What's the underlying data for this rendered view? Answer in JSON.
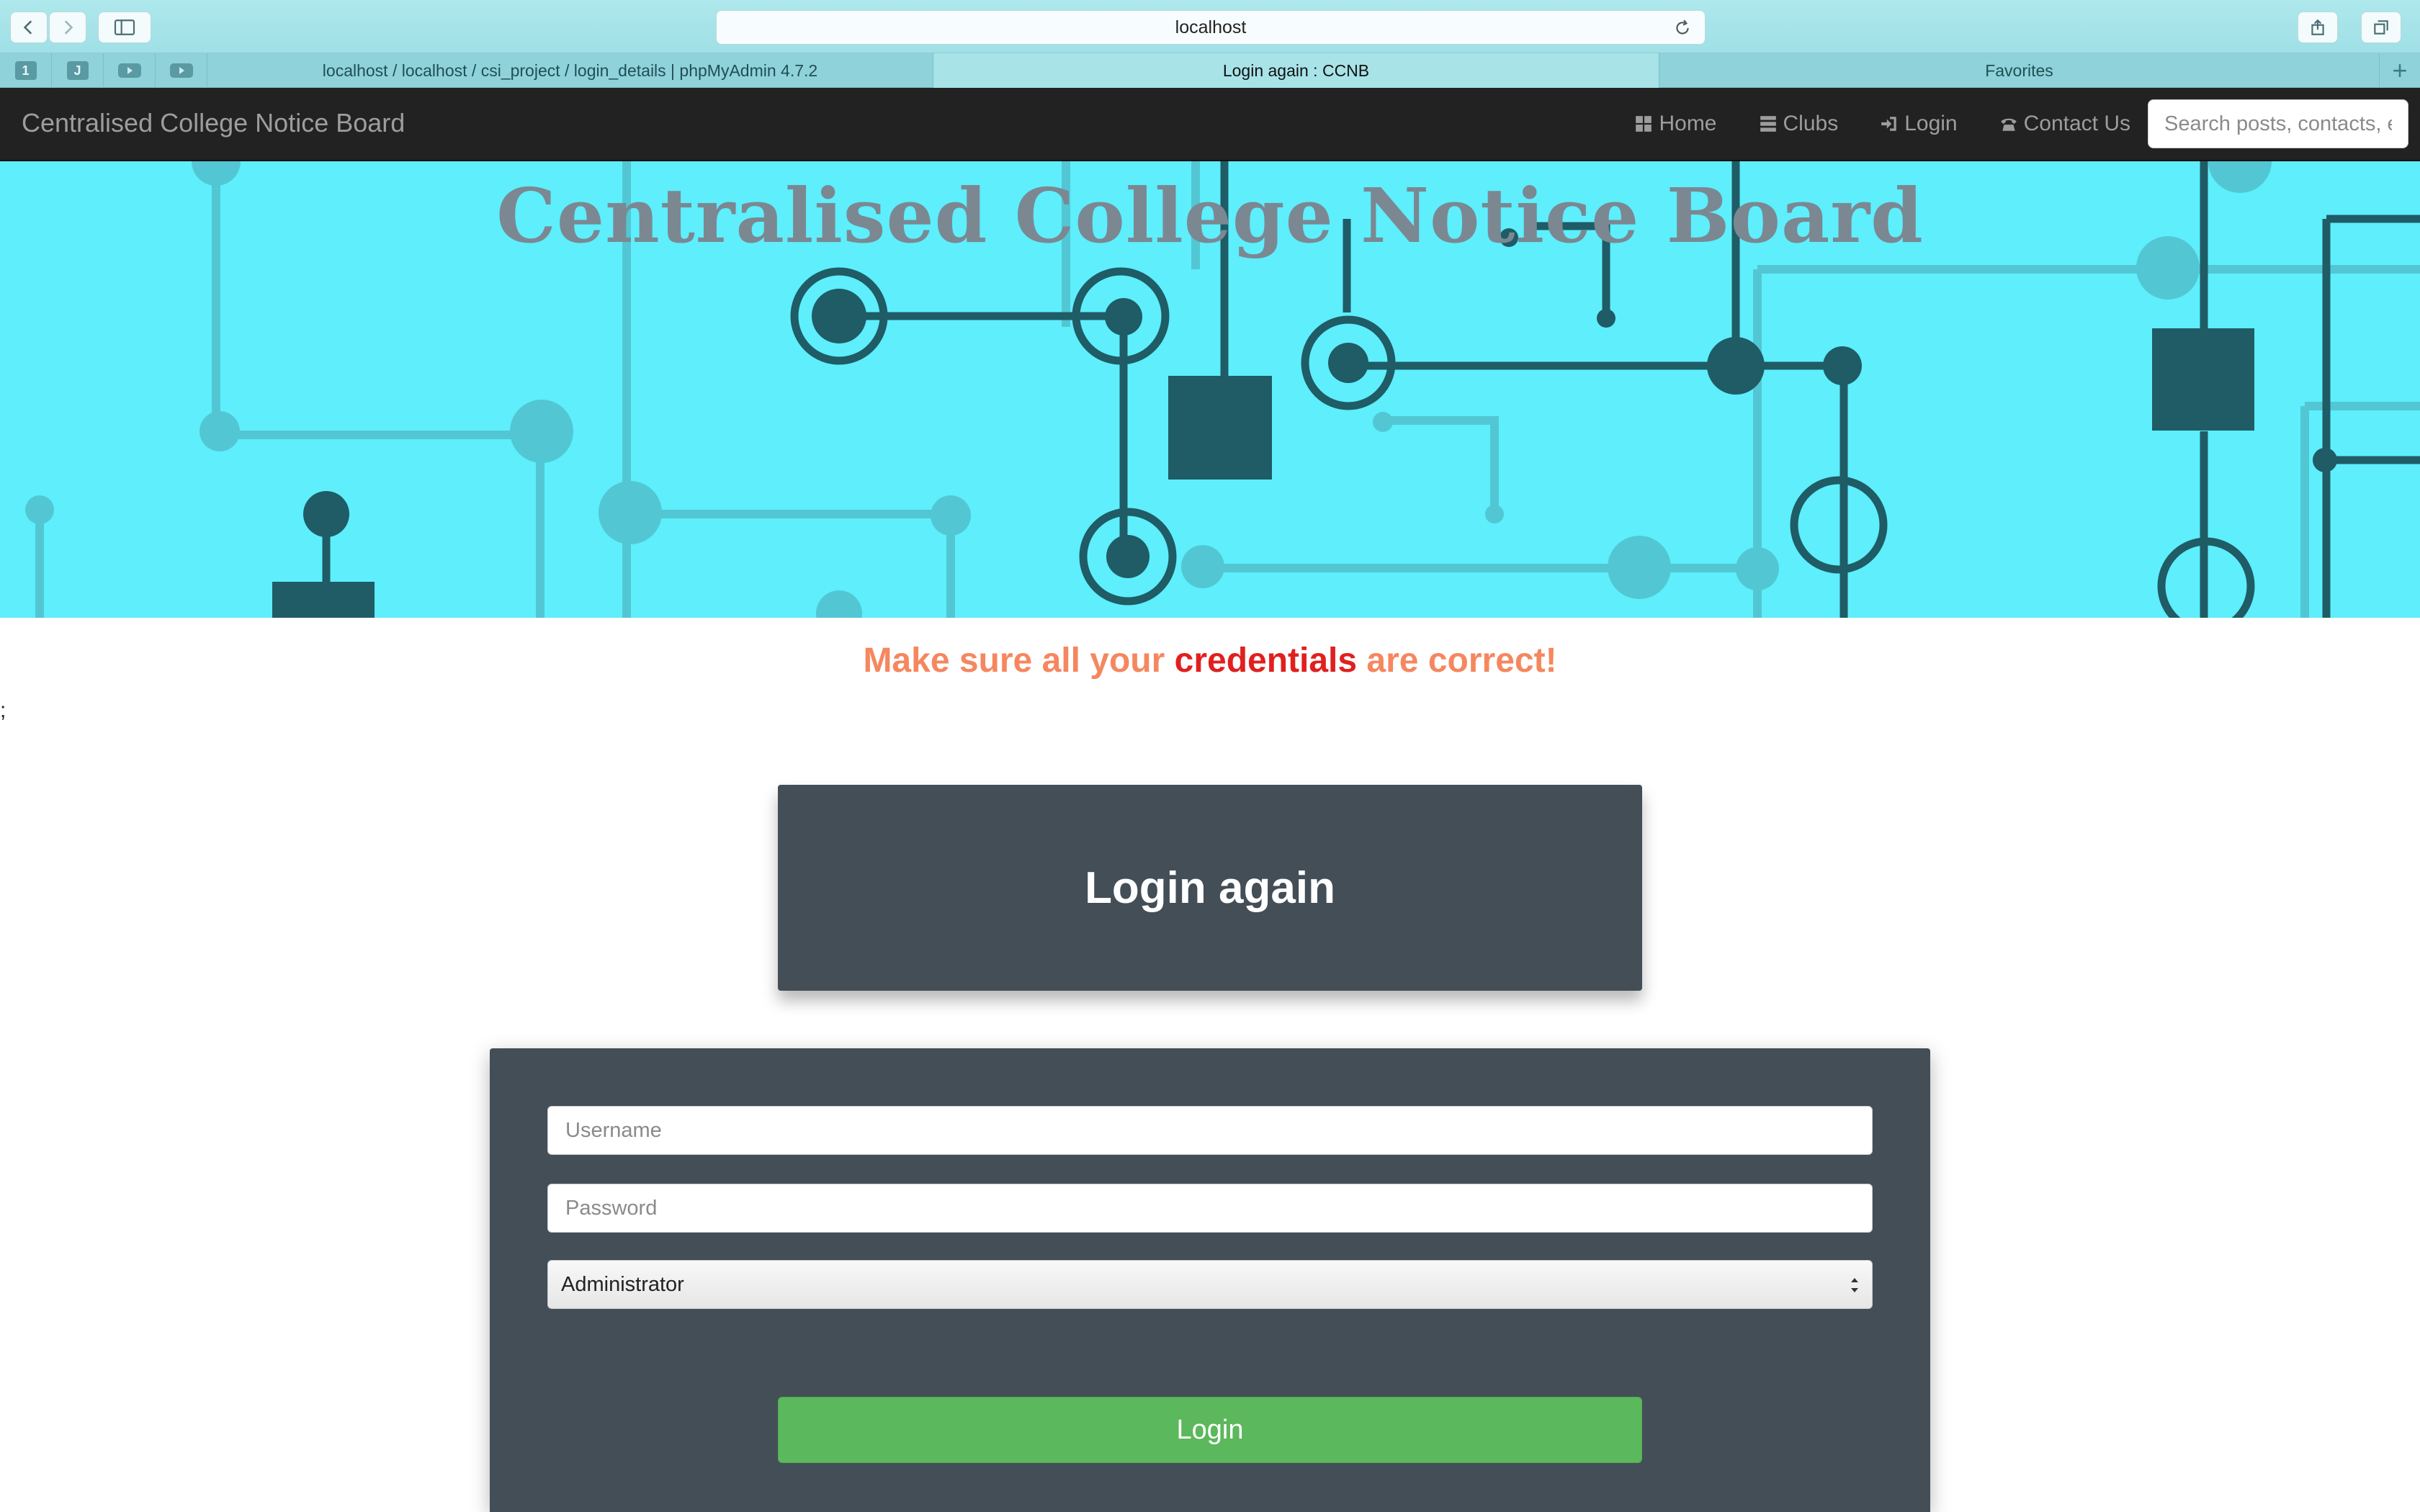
{
  "browser": {
    "url": "localhost",
    "tabs": [
      {
        "label": "localhost / localhost / csi_project / login_details | phpMyAdmin 4.7.2",
        "active": false
      },
      {
        "label": "Login again : CCNB",
        "active": true
      },
      {
        "label": "Favorites",
        "active": false
      }
    ],
    "pinned": [
      "1",
      "J"
    ]
  },
  "navbar": {
    "brand": "Centralised College Notice Board",
    "links": [
      {
        "label": "Home",
        "icon": "grid-icon"
      },
      {
        "label": "Clubs",
        "icon": "list-icon"
      },
      {
        "label": "Login",
        "icon": "sign-in-icon"
      },
      {
        "label": "Contact Us",
        "icon": "phone-icon"
      }
    ],
    "search_placeholder": "Search posts, contacts, etc"
  },
  "banner": {
    "title": "Centralised College Notice Board",
    "background": "#5eeefc",
    "circuit_color": "#1f5c66"
  },
  "message": {
    "part1": "Make sure all your ",
    "highlight": "credentials",
    "part2": " are correct!",
    "color": "#f5875f",
    "highlight_color": "#e0201f"
  },
  "stray_text": ";",
  "login": {
    "heading": "Login again",
    "username_placeholder": "Username",
    "password_placeholder": "Password",
    "role_selected": "Administrator",
    "button": "Login",
    "button_color": "#5cb85c",
    "panel_color": "#434e57"
  }
}
